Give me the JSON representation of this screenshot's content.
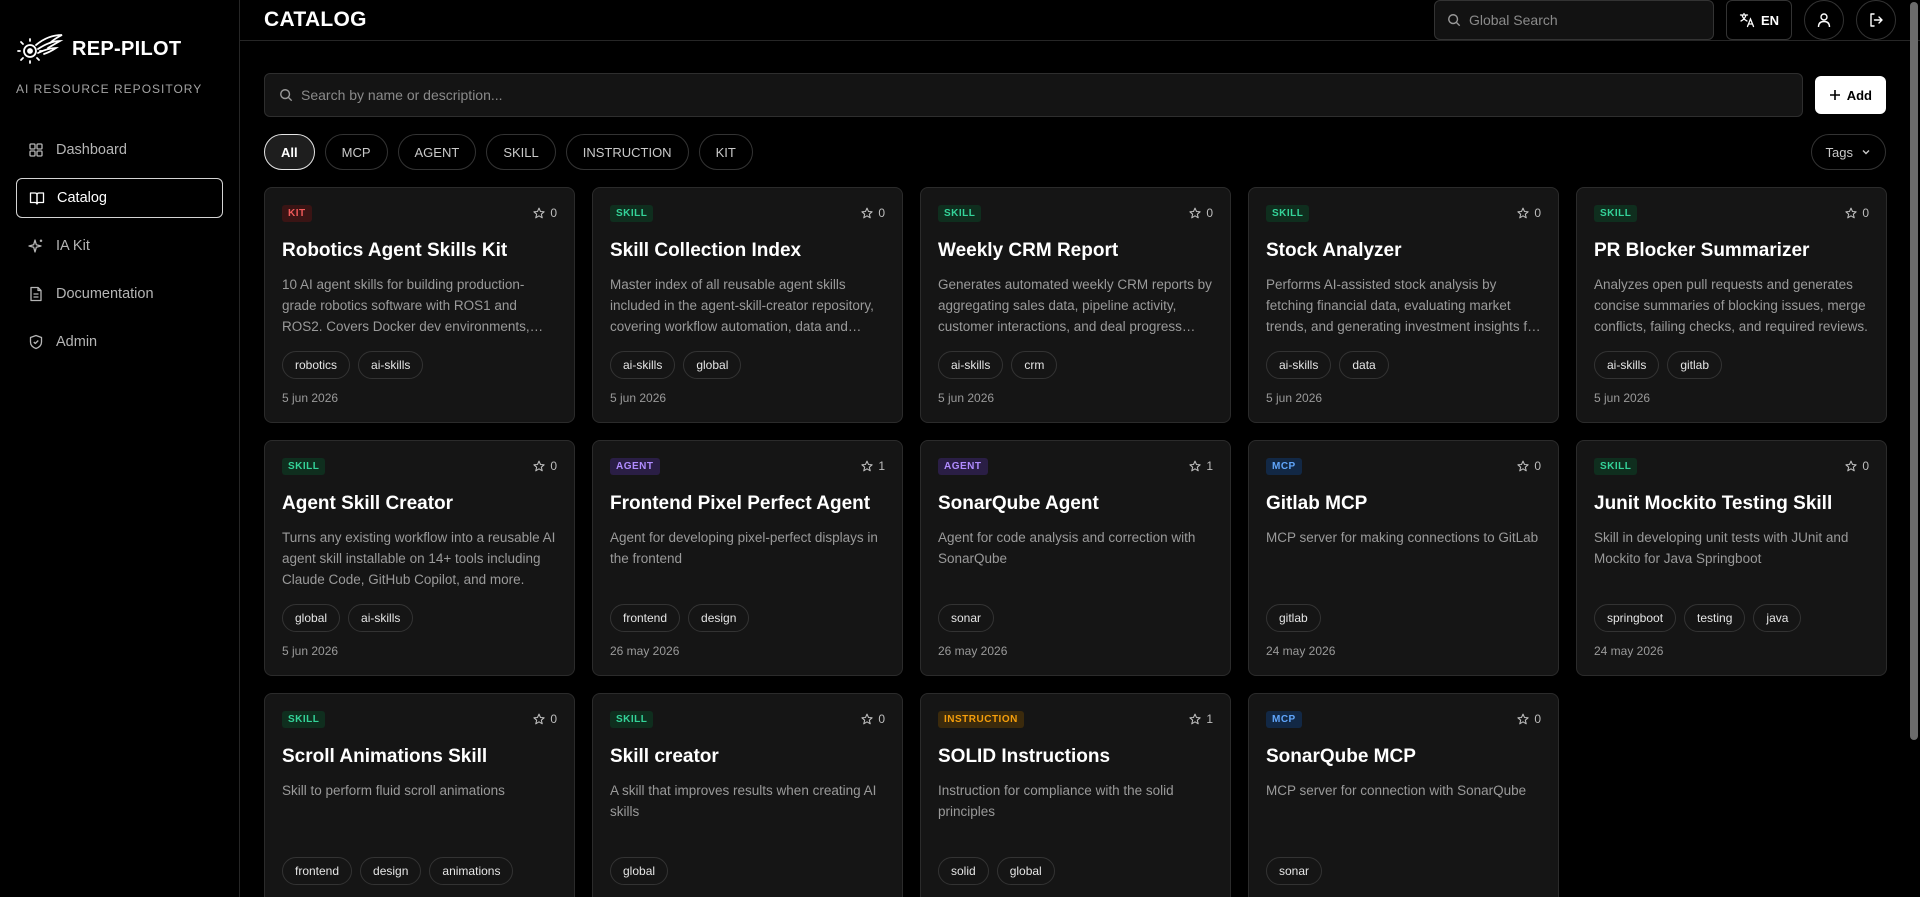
{
  "brand": {
    "name": "REP-PILOT",
    "subtitle": "AI RESOURCE REPOSITORY"
  },
  "sidebar": {
    "items": [
      {
        "label": "Dashboard",
        "icon": "grid-icon",
        "active": false
      },
      {
        "label": "Catalog",
        "icon": "book-icon",
        "active": true
      },
      {
        "label": "IA Kit",
        "icon": "sparkles-icon",
        "active": false
      },
      {
        "label": "Documentation",
        "icon": "document-icon",
        "active": false
      },
      {
        "label": "Admin",
        "icon": "shield-icon",
        "active": false
      }
    ]
  },
  "header": {
    "title": "CATALOG",
    "global_search_placeholder": "Global Search",
    "language": "EN"
  },
  "toolbar": {
    "search_placeholder": "Search by name or description...",
    "add_label": "Add"
  },
  "filters": {
    "types": [
      "All",
      "MCP",
      "AGENT",
      "SKILL",
      "INSTRUCTION",
      "KIT"
    ],
    "active": "All",
    "tags_label": "Tags"
  },
  "cards": [
    {
      "type": "KIT",
      "stars": "0",
      "title": "Robotics Agent Skills Kit",
      "description": "10 AI agent skills for building production-grade robotics software with ROS1 and ROS2. Covers Docker dev environments, launch files and more.",
      "tags": [
        "robotics",
        "ai-skills"
      ],
      "date": "5 jun 2026"
    },
    {
      "type": "SKILL",
      "stars": "0",
      "title": "Skill Collection Index",
      "description": "Master index of all reusable agent skills included in the agent-skill-creator repository, covering workflow automation, data and more.",
      "tags": [
        "ai-skills",
        "global"
      ],
      "date": "5 jun 2026"
    },
    {
      "type": "SKILL",
      "stars": "0",
      "title": "Weekly CRM Report",
      "description": "Generates automated weekly CRM reports by aggregating sales data, pipeline activity, customer interactions, and deal progress summaries.",
      "tags": [
        "ai-skills",
        "crm"
      ],
      "date": "5 jun 2026"
    },
    {
      "type": "SKILL",
      "stars": "0",
      "title": "Stock Analyzer",
      "description": "Performs AI-assisted stock analysis by fetching financial data, evaluating market trends, and generating investment insights for users.",
      "tags": [
        "ai-skills",
        "data"
      ],
      "date": "5 jun 2026"
    },
    {
      "type": "SKILL",
      "stars": "0",
      "title": "PR Blocker Summarizer",
      "description": "Analyzes open pull requests and generates concise summaries of blocking issues, merge conflicts, failing checks, and required reviews.",
      "tags": [
        "ai-skills",
        "gitlab"
      ],
      "date": "5 jun 2026"
    },
    {
      "type": "SKILL",
      "stars": "0",
      "title": "Agent Skill Creator",
      "description": "Turns any existing workflow into a reusable AI agent skill installable on 14+ tools including Claude Code, GitHub Copilot, and more.",
      "tags": [
        "global",
        "ai-skills"
      ],
      "date": "5 jun 2026"
    },
    {
      "type": "AGENT",
      "stars": "1",
      "title": "Frontend Pixel Perfect Agent",
      "description": "Agent for developing pixel-perfect displays in the frontend",
      "tags": [
        "frontend",
        "design"
      ],
      "date": "26 may 2026"
    },
    {
      "type": "AGENT",
      "stars": "1",
      "title": "SonarQube Agent",
      "description": "Agent for code analysis and correction with SonarQube",
      "tags": [
        "sonar"
      ],
      "date": "26 may 2026"
    },
    {
      "type": "MCP",
      "stars": "0",
      "title": "Gitlab MCP",
      "description": "MCP server for making connections to GitLab",
      "tags": [
        "gitlab"
      ],
      "date": "24 may 2026"
    },
    {
      "type": "SKILL",
      "stars": "0",
      "title": "Junit Mockito Testing Skill",
      "description": "Skill in developing unit tests with JUnit and Mockito for Java Springboot",
      "tags": [
        "springboot",
        "testing",
        "java"
      ],
      "date": "24 may 2026"
    },
    {
      "type": "SKILL",
      "stars": "0",
      "title": "Scroll Animations Skill",
      "description": "Skill to perform fluid scroll animations",
      "tags": [
        "frontend",
        "design",
        "animations"
      ],
      "date": ""
    },
    {
      "type": "SKILL",
      "stars": "0",
      "title": "Skill creator",
      "description": "A skill that improves results when creating AI skills",
      "tags": [
        "global"
      ],
      "date": ""
    },
    {
      "type": "INSTRUCTION",
      "stars": "1",
      "title": "SOLID Instructions",
      "description": "Instruction for compliance with the solid principles",
      "tags": [
        "solid",
        "global"
      ],
      "date": ""
    },
    {
      "type": "MCP",
      "stars": "0",
      "title": "SonarQube MCP",
      "description": "MCP server for connection with SonarQube",
      "tags": [
        "sonar"
      ],
      "date": ""
    }
  ]
}
